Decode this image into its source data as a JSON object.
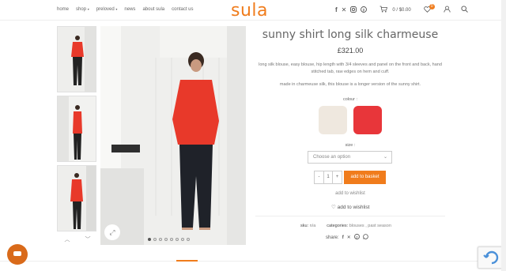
{
  "nav": {
    "items": [
      {
        "label": "home"
      },
      {
        "label": "shop"
      },
      {
        "label": "preloved"
      },
      {
        "label": "news"
      },
      {
        "label": "about sula"
      },
      {
        "label": "contact us"
      }
    ]
  },
  "brand": {
    "logo": "sula",
    "accent": "#f07c1c"
  },
  "header_icons": {
    "cart_value": "0 / $0.00",
    "wishlist_count": "0",
    "icons": [
      "facebook-icon",
      "x-icon",
      "instagram-icon",
      "pinterest-icon",
      "cart-icon",
      "heart-icon",
      "user-icon",
      "search-icon"
    ]
  },
  "product": {
    "title": "sunny shirt long silk charmeuse",
    "price": "£321.00",
    "description": "long silk blouse, easy blouse, hip length with 3/4 sleeves and panel on the front and back, hand stitched tab, raw edges on hem and cuff.",
    "description2": "made in charmeuse silk, this blouse is a longer version of the sunny shirt.",
    "colour_label": "colour :",
    "colours": [
      {
        "name": "cream",
        "hex": "#efe8df"
      },
      {
        "name": "red",
        "hex": "#e8363a"
      }
    ],
    "size_label": "size :",
    "size_placeholder": "Choose an option",
    "qty_minus": "-",
    "qty_value": "1",
    "qty_plus": "+",
    "add_to_basket": "add to basket",
    "add_to_wishlist_link": "add to wishlist",
    "add_to_wishlist_button": "add to wishlist",
    "sku_label": "sku:",
    "sku_value": "n/a",
    "categories_label": "categories:",
    "categories_value": "blouses , past season",
    "share_label": "share:"
  }
}
